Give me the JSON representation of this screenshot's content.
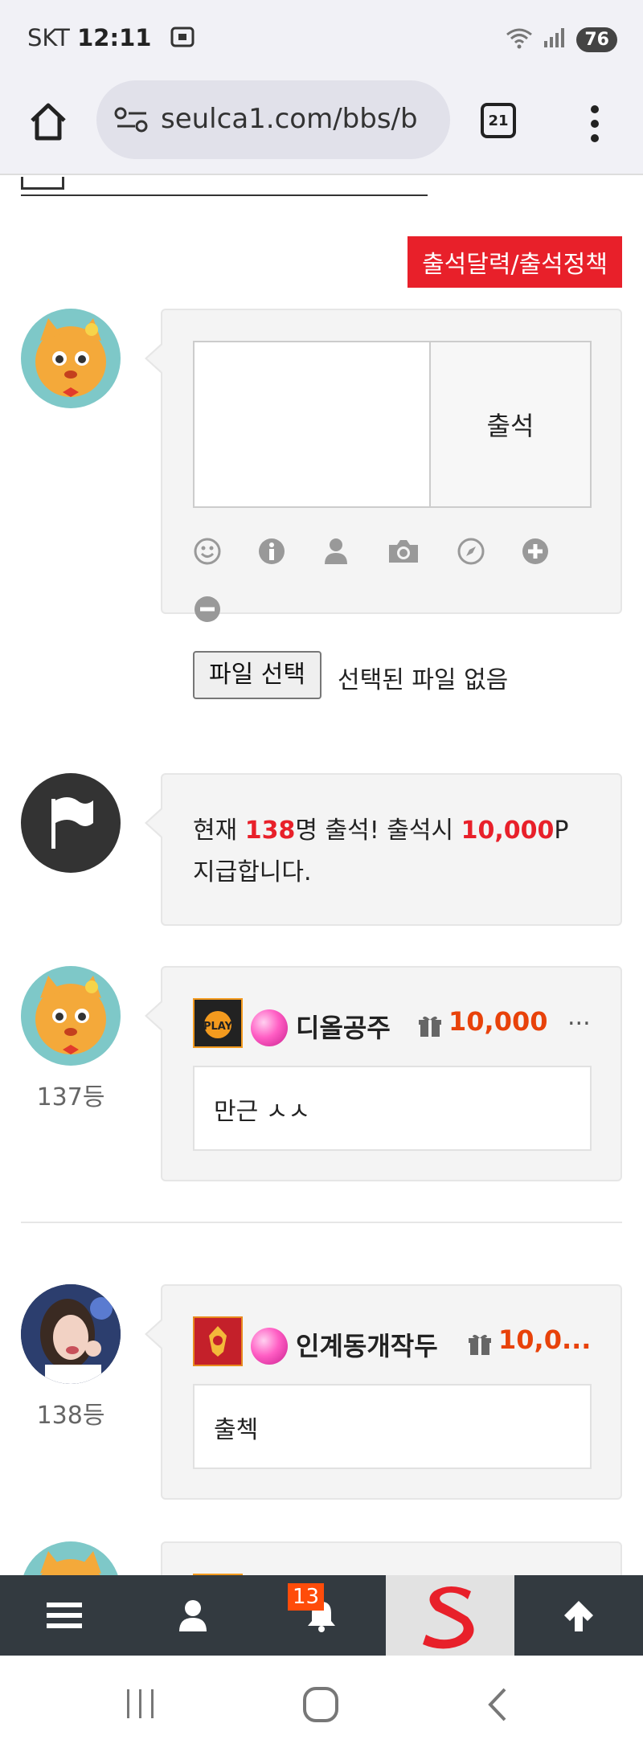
{
  "status_bar": {
    "carrier": "SKT",
    "time": "12:11",
    "battery": "76"
  },
  "browser": {
    "url": "seulca1.com/bbs/b",
    "tab_count": "21"
  },
  "attendance": {
    "policy_button": "출석달력/출석정책",
    "submit_label": "출석",
    "file_button": "파일 선택",
    "file_status": "선택된 파일 없음",
    "toolbar_icons": [
      "smile-icon",
      "info-icon",
      "user-icon",
      "camera-icon",
      "compass-icon",
      "plus-circle-icon",
      "minus-circle-icon"
    ]
  },
  "notice": {
    "prefix": "현재 ",
    "count": "138",
    "middle": "명 출석! 출석시 ",
    "points": "10,000",
    "suffix": "P",
    "line2": "지급합니다."
  },
  "entries": [
    {
      "rank": "137등",
      "name": "디올공주",
      "points": "10,000",
      "more": "...",
      "comment": "만근 ㅅㅅ"
    },
    {
      "rank": "138등",
      "name": "인계동개작두",
      "points": "10,0...",
      "comment": "출첵"
    }
  ],
  "bottom_nav": {
    "notification_count": "13"
  },
  "colors": {
    "accent_red": "#e8202a",
    "points_orange": "#e8420a",
    "nav_bg": "#333a40"
  }
}
